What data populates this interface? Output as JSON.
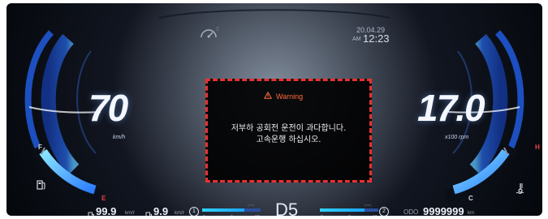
{
  "datetime": {
    "date": "20.04.29",
    "ampm": "AM",
    "time": "12:23"
  },
  "speedometer": {
    "value": "70",
    "unit": "km/h"
  },
  "tachometer": {
    "value": "17.0",
    "unit": "x100 rpm"
  },
  "warning": {
    "title": "Warning",
    "line1": "저부하 공회전 운전이 과다합니다.",
    "line2": "고속운행 하십시오."
  },
  "fuel_gauge": {
    "full_label": "F",
    "empty_label": "E"
  },
  "temp_gauge": {
    "hot_label": "H",
    "cold_label": "C"
  },
  "bottom": {
    "fuel_economy_1": "99.9",
    "fuel_economy_1_unit": "km/ℓ",
    "fuel_economy_2": "9.9",
    "fuel_economy_2_unit": "km/ℓ",
    "gauge1": {
      "badge": "1",
      "unit": "(bar)",
      "ticks": [
        "0",
        "6",
        "12"
      ],
      "level": 0.72
    },
    "gear": "D5",
    "gauge2": {
      "badge": "2",
      "unit": "(bar)",
      "ticks": [
        "0",
        "6",
        "12"
      ],
      "level": 0.76
    },
    "odo_label": "ODO",
    "odometer": "9999999",
    "odometer_unit": "km"
  },
  "icons": {
    "top_center": "speedometer-small-icon",
    "fuel": "fuel-pump-icon",
    "coolant": "coolant-temperature-icon",
    "warning": "warning-triangle-icon"
  },
  "colors": {
    "warning_accent": "#ff6a3d",
    "warning_border": "#e83131",
    "needle_blue": "#4cc8ff",
    "red_alert": "#e44545"
  }
}
